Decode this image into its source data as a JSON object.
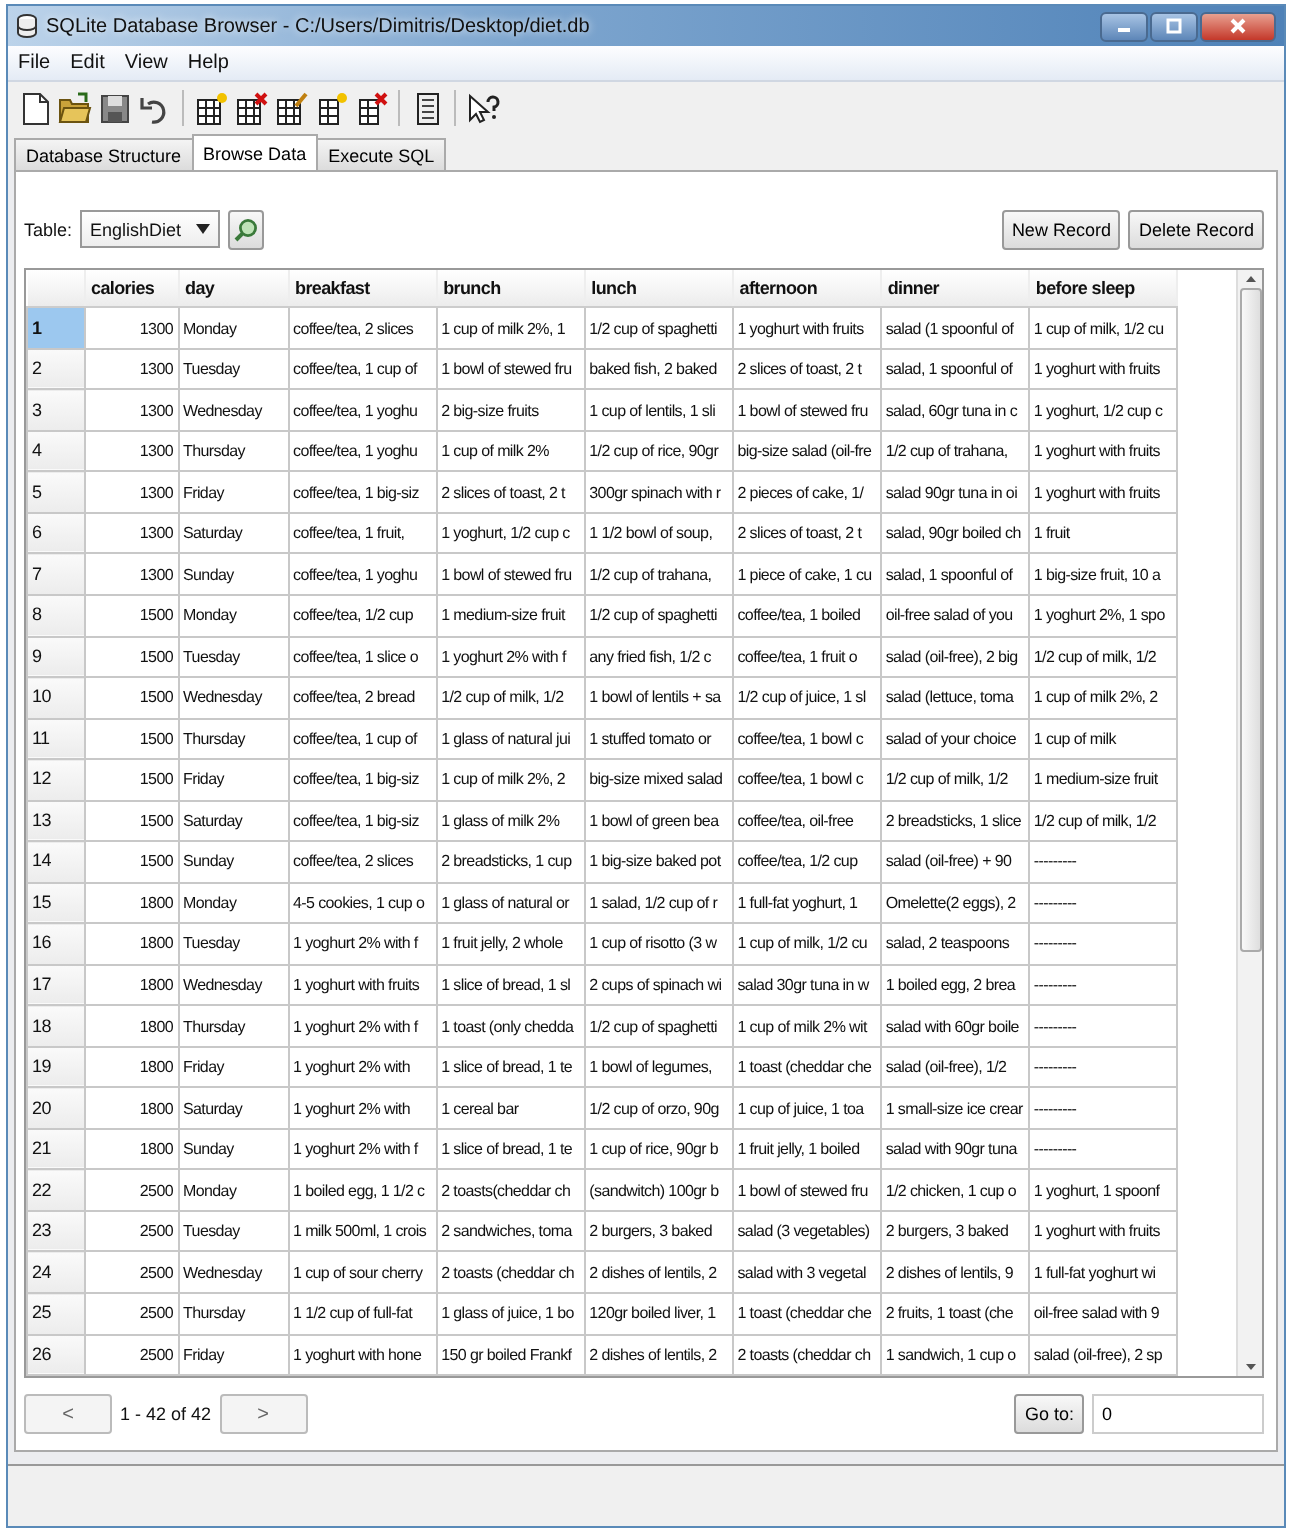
{
  "window": {
    "title": "SQLite Database Browser - C:/Users/Dimitris/Desktop/diet.db"
  },
  "menu": [
    "File",
    "Edit",
    "View",
    "Help"
  ],
  "tabs": [
    {
      "label": "Database Structure",
      "selected": false
    },
    {
      "label": "Browse Data",
      "selected": true
    },
    {
      "label": "Execute SQL",
      "selected": false
    }
  ],
  "table_selector": {
    "label": "Table:",
    "value": "EnglishDiet"
  },
  "buttons": [
    "New Record",
    "Delete Record"
  ],
  "grid": {
    "columns": [
      "calories",
      "day",
      "breakfast",
      "brunch",
      "lunch",
      "afternoon",
      "dinner",
      "before sleep"
    ],
    "rows": [
      {
        "number": "1",
        "selected": true,
        "cells": [
          "1300",
          "Monday",
          "coffee/tea, 2 slices",
          "1 cup of milk 2%, 1",
          "1/2 cup of spaghetti",
          "1 yoghurt with fruits",
          "salad (1 spoonful of",
          "1 cup of milk, 1/2 cu"
        ]
      },
      {
        "number": "2",
        "selected": false,
        "cells": [
          "1300",
          "Tuesday",
          "coffee/tea, 1 cup of",
          "1 bowl of stewed fru",
          "baked fish, 2 baked",
          "2 slices of toast, 2 t",
          "salad, 1 spoonful of",
          "1 yoghurt with fruits"
        ]
      },
      {
        "number": "3",
        "selected": false,
        "cells": [
          "1300",
          "Wednesday",
          "coffee/tea, 1 yoghu",
          "2 big-size fruits",
          "1 cup of lentils, 1 sli",
          "1 bowl of stewed fru",
          "salad, 60gr tuna in c",
          "1 yoghurt, 1/2 cup c"
        ]
      },
      {
        "number": "4",
        "selected": false,
        "cells": [
          "1300",
          "Thursday",
          "coffee/tea, 1 yoghu",
          "1 cup of milk 2%",
          "1/2 cup of rice, 90gr",
          "big-size salad (oil-fre",
          "1/2 cup of trahana,",
          "1 yoghurt with fruits"
        ]
      },
      {
        "number": "5",
        "selected": false,
        "cells": [
          "1300",
          "Friday",
          "coffee/tea, 1 big-siz",
          "2 slices of toast, 2 t",
          "300gr spinach with r",
          "2 pieces of cake, 1/",
          "salad 90gr tuna in oi",
          "1 yoghurt with fruits"
        ]
      },
      {
        "number": "6",
        "selected": false,
        "cells": [
          "1300",
          "Saturday",
          "coffee/tea, 1 fruit,",
          "1 yoghurt, 1/2 cup c",
          "1 1/2 bowl of soup,",
          "2 slices of toast, 2 t",
          "salad, 90gr boiled ch",
          "1 fruit"
        ]
      },
      {
        "number": "7",
        "selected": false,
        "cells": [
          "1300",
          "Sunday",
          "coffee/tea, 1 yoghu",
          "1 bowl of stewed fru",
          "1/2 cup of trahana,",
          "1 piece of cake, 1 cu",
          "salad, 1 spoonful of",
          "1 big-size fruit, 10 a"
        ]
      },
      {
        "number": "8",
        "selected": false,
        "cells": [
          "1500",
          "Monday",
          "coffee/tea, 1/2 cup",
          "1 medium-size fruit",
          "1/2 cup of spaghetti",
          "coffee/tea, 1 boiled",
          "oil-free salad of you",
          "1 yoghurt 2%, 1 spo"
        ]
      },
      {
        "number": "9",
        "selected": false,
        "cells": [
          "1500",
          "Tuesday",
          "coffee/tea, 1 slice o",
          "1 yoghurt 2% with f",
          "any fried fish, 1/2 c",
          "coffee/tea, 1 fruit o",
          "salad (oil-free), 2 big",
          "1/2 cup of milk, 1/2"
        ]
      },
      {
        "number": "10",
        "selected": false,
        "cells": [
          "1500",
          "Wednesday",
          "coffee/tea, 2 bread",
          "1/2 cup of milk, 1/2",
          "1 bowl of lentils + sa",
          "1/2 cup of juice, 1 sl",
          "salad (lettuce, toma",
          "1 cup of milk 2%, 2"
        ]
      },
      {
        "number": "11",
        "selected": false,
        "cells": [
          "1500",
          "Thursday",
          "coffee/tea, 1 cup of",
          "1 glass of natural jui",
          "1 stuffed tomato or",
          "coffee/tea, 1 bowl c",
          "salad of your choice",
          "1 cup of milk"
        ]
      },
      {
        "number": "12",
        "selected": false,
        "cells": [
          "1500",
          "Friday",
          "coffee/tea, 1 big-siz",
          "1 cup of milk 2%, 2",
          "big-size mixed salad",
          "coffee/tea, 1 bowl c",
          "1/2 cup of milk, 1/2",
          "1 medium-size fruit"
        ]
      },
      {
        "number": "13",
        "selected": false,
        "cells": [
          "1500",
          "Saturday",
          "coffee/tea, 1 big-siz",
          "1 glass of milk 2%",
          "1 bowl of green bea",
          "coffee/tea, oil-free",
          "2 breadsticks, 1 slice",
          "1/2 cup of milk, 1/2"
        ]
      },
      {
        "number": "14",
        "selected": false,
        "cells": [
          "1500",
          "Sunday",
          "coffee/tea, 2 slices",
          "2 breadsticks, 1 cup",
          "1 big-size baked pot",
          "coffee/tea, 1/2 cup",
          "salad (oil-free) + 90",
          "---------"
        ]
      },
      {
        "number": "15",
        "selected": false,
        "cells": [
          "1800",
          "Monday",
          "4-5 cookies, 1 cup o",
          "1 glass of natural or",
          "1 salad, 1/2 cup of r",
          "1 full-fat yoghurt, 1",
          "Omelette(2 eggs), 2",
          "---------"
        ]
      },
      {
        "number": "16",
        "selected": false,
        "cells": [
          "1800",
          "Tuesday",
          "1 yoghurt 2% with f",
          "1 fruit jelly, 2 whole",
          "1 cup of risotto (3 w",
          "1 cup of milk, 1/2 cu",
          "salad, 2 teaspoons",
          "---------"
        ]
      },
      {
        "number": "17",
        "selected": false,
        "cells": [
          "1800",
          "Wednesday",
          "1 yoghurt with fruits",
          "1 slice of bread, 1 sl",
          "2 cups of spinach wi",
          "salad 30gr tuna in w",
          "1 boiled egg, 2 brea",
          "---------"
        ]
      },
      {
        "number": "18",
        "selected": false,
        "cells": [
          "1800",
          "Thursday",
          "1 yoghurt 2% with f",
          "1 toast (only chedda",
          "1/2 cup of spaghetti",
          "1 cup of milk 2% wit",
          "salad with 60gr boile",
          "---------"
        ]
      },
      {
        "number": "19",
        "selected": false,
        "cells": [
          "1800",
          "Friday",
          "1 yoghurt 2% with",
          "1 slice of bread, 1 te",
          "1 bowl of legumes,",
          "1 toast (cheddar che",
          "salad (oil-free), 1/2",
          "---------"
        ]
      },
      {
        "number": "20",
        "selected": false,
        "cells": [
          "1800",
          "Saturday",
          "1 yoghurt 2% with",
          "1 cereal bar",
          "1/2 cup of orzo, 90g",
          "1 cup of juice, 1 toa",
          "1 small-size ice crear",
          "---------"
        ]
      },
      {
        "number": "21",
        "selected": false,
        "cells": [
          "1800",
          "Sunday",
          "1 yoghurt 2% with f",
          "1 slice of bread, 1 te",
          "1 cup of rice, 90gr b",
          "1 fruit jelly, 1 boiled",
          "salad with 90gr tuna",
          "---------"
        ]
      },
      {
        "number": "22",
        "selected": false,
        "cells": [
          "2500",
          "Monday",
          "1 boiled egg, 1 1/2 c",
          "2 toasts(cheddar ch",
          "(sandwitch) 100gr b",
          "1 bowl of stewed fru",
          "1/2 chicken, 1 cup o",
          "1 yoghurt, 1 spoonf"
        ]
      },
      {
        "number": "23",
        "selected": false,
        "cells": [
          "2500",
          "Tuesday",
          "1 milk 500ml, 1 crois",
          "2 sandwiches, toma",
          "2 burgers, 3 baked",
          "salad (3 vegetables)",
          "2 burgers, 3 baked",
          "1 yoghurt with fruits"
        ]
      },
      {
        "number": "24",
        "selected": false,
        "cells": [
          "2500",
          "Wednesday",
          "1 cup of sour cherry",
          "2 toasts (cheddar ch",
          "2 dishes of lentils, 2",
          "salad with 3 vegetal",
          "2 dishes of lentils, 9",
          "1 full-fat yoghurt wi"
        ]
      },
      {
        "number": "25",
        "selected": false,
        "cells": [
          "2500",
          "Thursday",
          "1 1/2 cup of full-fat",
          "1 glass of juice, 1 bo",
          "120gr boiled liver, 1",
          "1 toast (cheddar che",
          "2 fruits, 1 toast (che",
          "oil-free salad with 9"
        ]
      },
      {
        "number": "26",
        "selected": false,
        "cells": [
          "2500",
          "Friday",
          "1 yoghurt with hone",
          "150 gr boiled Frankf",
          "2 dishes of lentils, 2",
          "2 toasts (cheddar ch",
          "1 sandwich, 1 cup o",
          "salad (oil-free), 2 sp"
        ]
      }
    ]
  },
  "pager": {
    "prev": "<",
    "range": "1 - 42 of 42",
    "next": ">",
    "goto_label": "Go to:",
    "goto_value": "0"
  }
}
